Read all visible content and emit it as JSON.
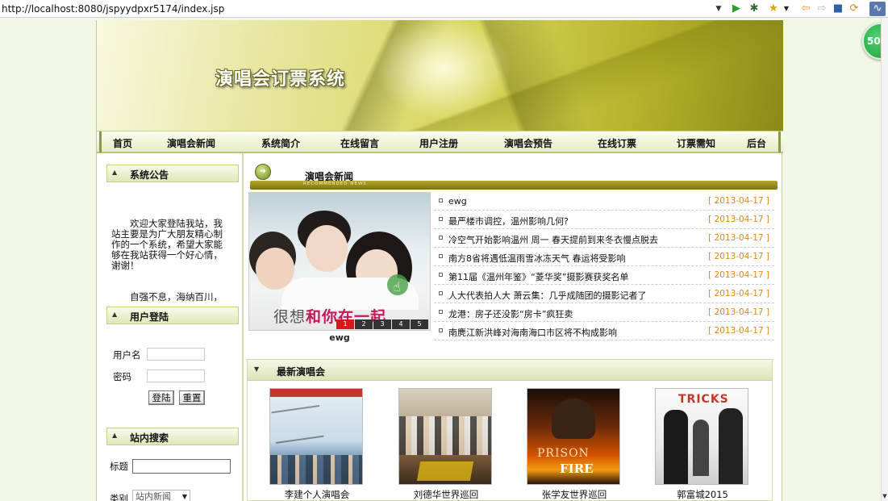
{
  "browser": {
    "url": "http://localhost:8080/jspyydpxr5174/index.jsp",
    "badge": "50"
  },
  "site": {
    "title": "演唱会订票系统"
  },
  "nav": {
    "items": [
      "首页",
      "演唱会新闻",
      "系统简介",
      "在线留言",
      "用户注册",
      "演唱会预告",
      "在线订票",
      "订票需知",
      "后台"
    ]
  },
  "sidebar": {
    "notice_title": "系统公告",
    "notice_text": "欢迎大家登陆我站，我站主要是为广大朋友精心制作的一个系统，希望大家能够在我站获得一个好心情，谢谢！",
    "notice_text2": "自强不息，海纳百川，毅",
    "login_title": "用户登陆",
    "username_label": "用户名",
    "password_label": "密码",
    "login_button": "登陆",
    "reset_button": "重置",
    "search_title": "站内搜索",
    "search_label": "标题",
    "category_label": "类别",
    "category_value": "站内新闻"
  },
  "news": {
    "title": "演唱会新闻",
    "subtitle": "RECOMMENDED NEWS",
    "slide_caption_a": "很想",
    "slide_caption_b": "和你在一起",
    "slide_label": "ewg",
    "pager": [
      "1",
      "2",
      "3",
      "4",
      "5"
    ],
    "items": [
      {
        "title": "ewg",
        "date": "[ 2013-04-17 ]"
      },
      {
        "title": "最严楼市调控，温州影响几何?",
        "date": "[ 2013-04-17 ]"
      },
      {
        "title": "冷空气开始影响温州 周一 春天提前到来冬衣慢点脱去",
        "date": "[ 2013-04-17 ]"
      },
      {
        "title": "南方8省将遇低温雨雪冰冻天气 春运将受影响",
        "date": "[ 2013-04-17 ]"
      },
      {
        "title": "第11届《温州年鉴》“菱华奖”摄影赛获奖名单",
        "date": "[ 2013-04-17 ]"
      },
      {
        "title": "人大代表拍人大 萧云集：几乎成随团的摄影记者了",
        "date": "[ 2013-04-17 ]"
      },
      {
        "title": "龙港：房子还没影“房卡”疯狂卖",
        "date": "[ 2013-04-17 ]"
      },
      {
        "title": "南麂江新洪峰对海南海口市区将不构成影响",
        "date": "[ 2013-04-17 ]"
      }
    ]
  },
  "latest": {
    "title": "最新演唱会",
    "items": [
      {
        "name": "李建个人演唱会"
      },
      {
        "name": "刘德华世界巡回"
      },
      {
        "name": "张学友世界巡回"
      },
      {
        "name": "郭富城2015"
      }
    ],
    "poster3_text_a": "PRISON",
    "poster3_text_b": "FIRE",
    "poster4_text": "TRICKS"
  }
}
